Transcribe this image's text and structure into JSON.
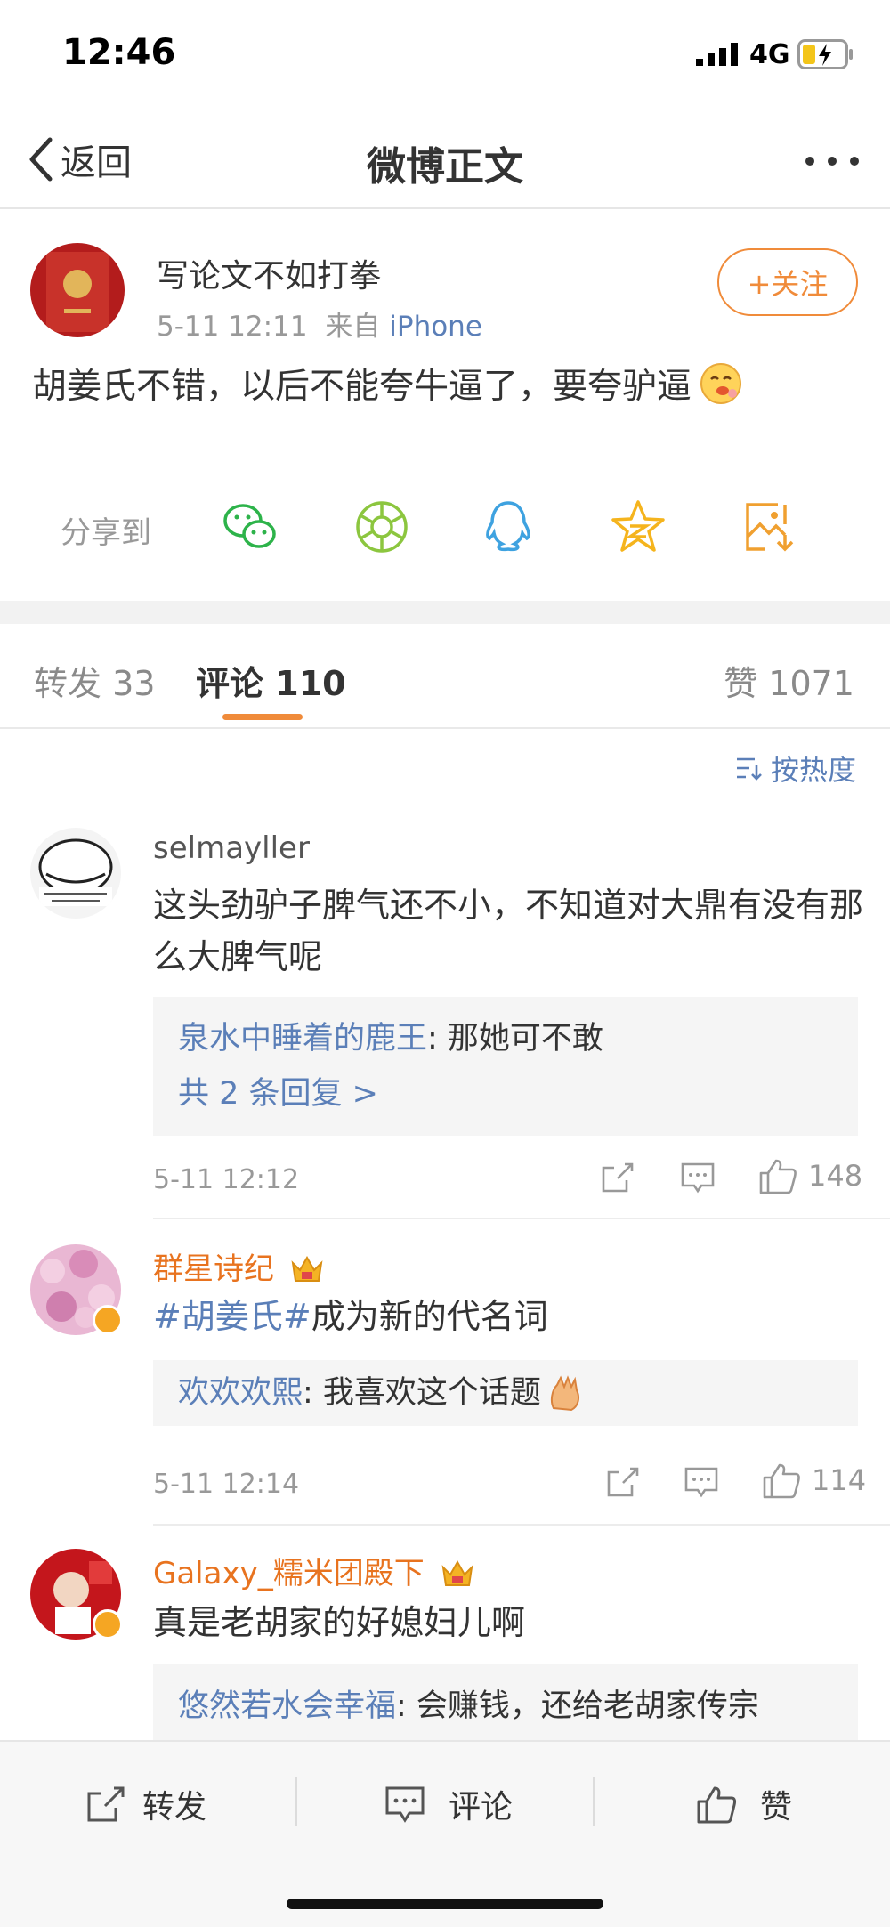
{
  "status_bar": {
    "time": "12:46",
    "network": "4G"
  },
  "nav": {
    "back_label": "返回",
    "title": "微博正文"
  },
  "post": {
    "author": "写论文不如打拳",
    "date": "5-11 12:11",
    "from_label": "来自",
    "source": "iPhone",
    "follow_label": "+关注",
    "text": "胡姜氏不错，以后不能夸牛逼了，要夸驴逼",
    "share_label": "分享到",
    "share_targets": [
      "wechat-icon",
      "moments-icon",
      "qq-icon",
      "qzone-icon",
      "save-image-icon"
    ]
  },
  "tabs": {
    "repost_label": "转发",
    "repost_count": "33",
    "comment_label": "评论",
    "comment_count": "110",
    "like_label": "赞",
    "like_count": "1071"
  },
  "sort_label": "按热度",
  "comments": [
    {
      "name": "selmayller",
      "text": "这头劲驴子脾气还不小，不知道对大鼎有没有那么大脾气呢",
      "reply_name": "泉水中睡着的鹿王",
      "reply_text": ": 那她可不敢",
      "reply_more": "共 2 条回复 >",
      "time": "5-11 12:12",
      "likes": "148"
    },
    {
      "name": "群星诗纪",
      "tag": "#胡姜氏#",
      "text": "成为新的代名词",
      "reply_name": "欢欢欢熙",
      "reply_text": ": 我喜欢这个话题",
      "time": "5-11 12:14",
      "likes": "114"
    },
    {
      "name": "Galaxy_糯米团殿下",
      "text": "真是老胡家的好媳妇儿啊",
      "reply_name": "悠然若水会幸福",
      "reply_text": ": 会赚钱，还给老胡家传宗"
    }
  ],
  "bottom_bar": {
    "repost": "转发",
    "comment": "评论",
    "like": "赞"
  },
  "colors": {
    "accent_orange": "#f08b3a",
    "link_blue": "#5b7fb8",
    "vip_orange": "#e8731f"
  }
}
